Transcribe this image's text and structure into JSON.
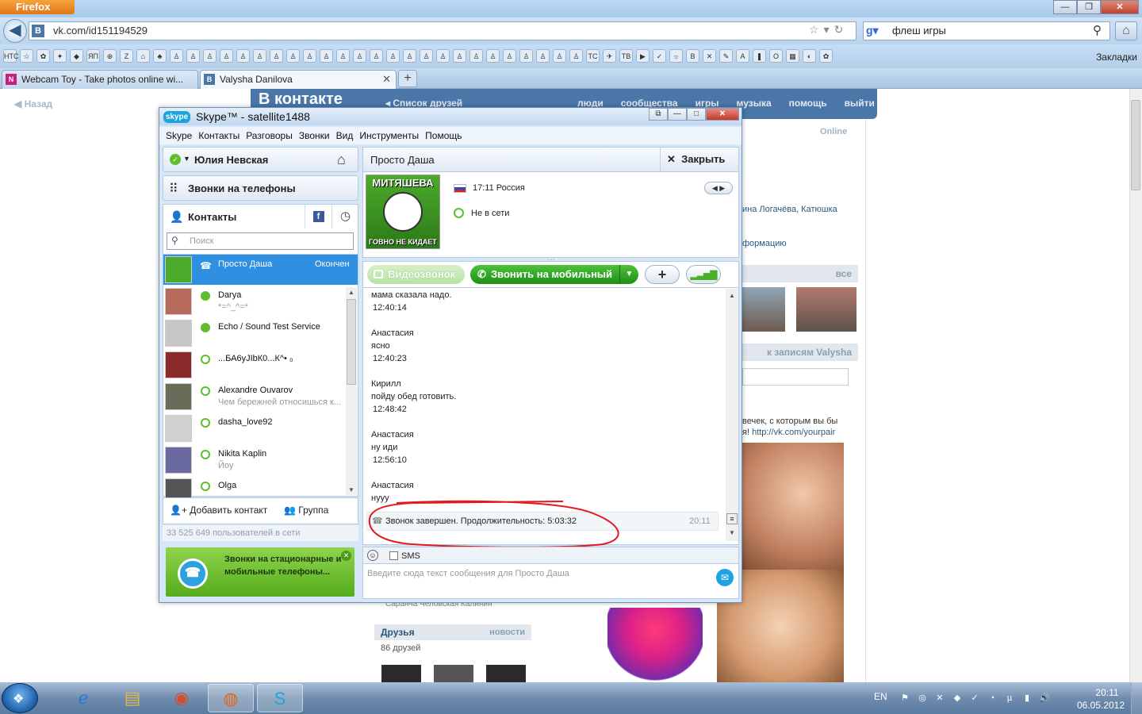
{
  "browser": {
    "menu_button": "Firefox",
    "url": "vk.com/id151194529",
    "search_query": "флеш игры",
    "bookmarks_label": "Закладки",
    "bookmark_icons": [
      "НТС",
      "☆",
      "✿",
      "✦",
      "◆",
      "ЯП",
      "⊕",
      "Z",
      "⌂",
      "♣",
      "♙",
      "♙",
      "♙",
      "♙",
      "♙",
      "♙",
      "♙",
      "♙",
      "♙",
      "♙",
      "♙",
      "♙",
      "♙",
      "♙",
      "♙",
      "♙",
      "♙",
      "♙",
      "♙",
      "♙",
      "♙",
      "♙",
      "♙",
      "♙",
      "♙",
      "TC",
      "✈",
      "TB",
      "▶",
      "✓",
      "☼",
      "B",
      "✕",
      "✎",
      "A",
      "❚",
      "O",
      "▦",
      "◐",
      "✿"
    ],
    "tabs": [
      {
        "title": "Webcam Toy - Take photos online wi...",
        "favicon": "N",
        "color": "#c8207a"
      },
      {
        "title": "Valysha Danilova",
        "favicon": "B",
        "color": "#4a76a8"
      }
    ]
  },
  "vk": {
    "back": "Назад",
    "logo": "В контакте",
    "friends_list": "Список друзей",
    "nav": [
      "люди",
      "сообщества",
      "игры",
      "музыка",
      "помощь",
      "выйти"
    ],
    "online": "Online",
    "friend_names": "ина Логачёва, Катюшка",
    "info_link": "формацию",
    "all_link": "все",
    "wall_link": "к записям Valysha",
    "ad_text": "вечек, с которым вы бы",
    "ad_text2": "я!",
    "ad_link": "http://vk.com/yourpair",
    "small_names": "Саранча      Человская      Калинин",
    "friends_header": "Друзья",
    "news_link": "новости",
    "friends_count": "86 друзей"
  },
  "skype": {
    "logo": "skype",
    "title": "Skype™ - satellite1488",
    "menu": [
      "Skype",
      "Контакты",
      "Разговоры",
      "Звонки",
      "Вид",
      "Инструменты",
      "Помощь"
    ],
    "user_name": "Юлия Невская",
    "phones": "Звонки на телефоны",
    "contacts_tab": "Контакты",
    "search_placeholder": "Поиск",
    "selected_contact": {
      "name": "Просто Даша",
      "status": "Окончен"
    },
    "contacts": [
      {
        "name": "Darya",
        "sub": "*=^_^=*",
        "online": true
      },
      {
        "name": "Echo / Sound Test Service",
        "sub": "",
        "online": true
      },
      {
        "name": "...БА6уJIbК0...К^• ₀",
        "sub": "",
        "online": false
      },
      {
        "name": "Alexandre Ouvarov",
        "sub": "Чем бережней относишься к...",
        "online": false
      },
      {
        "name": "dasha_love92",
        "sub": "",
        "online": false
      },
      {
        "name": "Nikita Kaplin",
        "sub": "Йоу",
        "online": false
      },
      {
        "name": "Olga",
        "sub": "",
        "online": false
      }
    ],
    "add_contact": "Добавить контакт",
    "group": "Группа",
    "users_online": "33 525 649 пользователей в сети",
    "promo": "Звонки на стационарные и мобильные телефоны...",
    "conversation": {
      "name": "Просто Даша",
      "close": "Закрыть",
      "avatar_top": "МИТЯШЕВА",
      "avatar_bottom": "ГОВНО НЕ КИДАЕТ",
      "local_time": "17:11 Россия",
      "status": "Не в сети",
      "video_call": "Видеозвонок",
      "call_mobile": "Звонить на мобильный",
      "messages": [
        {
          "author": "",
          "text": "мама сказала надо.",
          "time": "12:40:14"
        },
        {
          "author": "Анастасия",
          "text": "ясно",
          "time": "12:40:23"
        },
        {
          "author": "Кирилл",
          "text": "пойду обед готовить.",
          "time": "12:48:42"
        },
        {
          "author": "Анастасия",
          "text": "ну иди",
          "time": "12:56:10"
        },
        {
          "author": "Анастасия",
          "text": "нууу",
          "time": ""
        }
      ],
      "call_ended": "Звонок завершен. Продолжительность: 5:03:32",
      "call_ended_time": "20:11",
      "sms_label": "SMS",
      "input_placeholder": "Введите сюда текст сообщения для Просто Даша"
    }
  },
  "taskbar": {
    "lang": "EN",
    "time": "20:11",
    "date": "06.05.2012"
  }
}
